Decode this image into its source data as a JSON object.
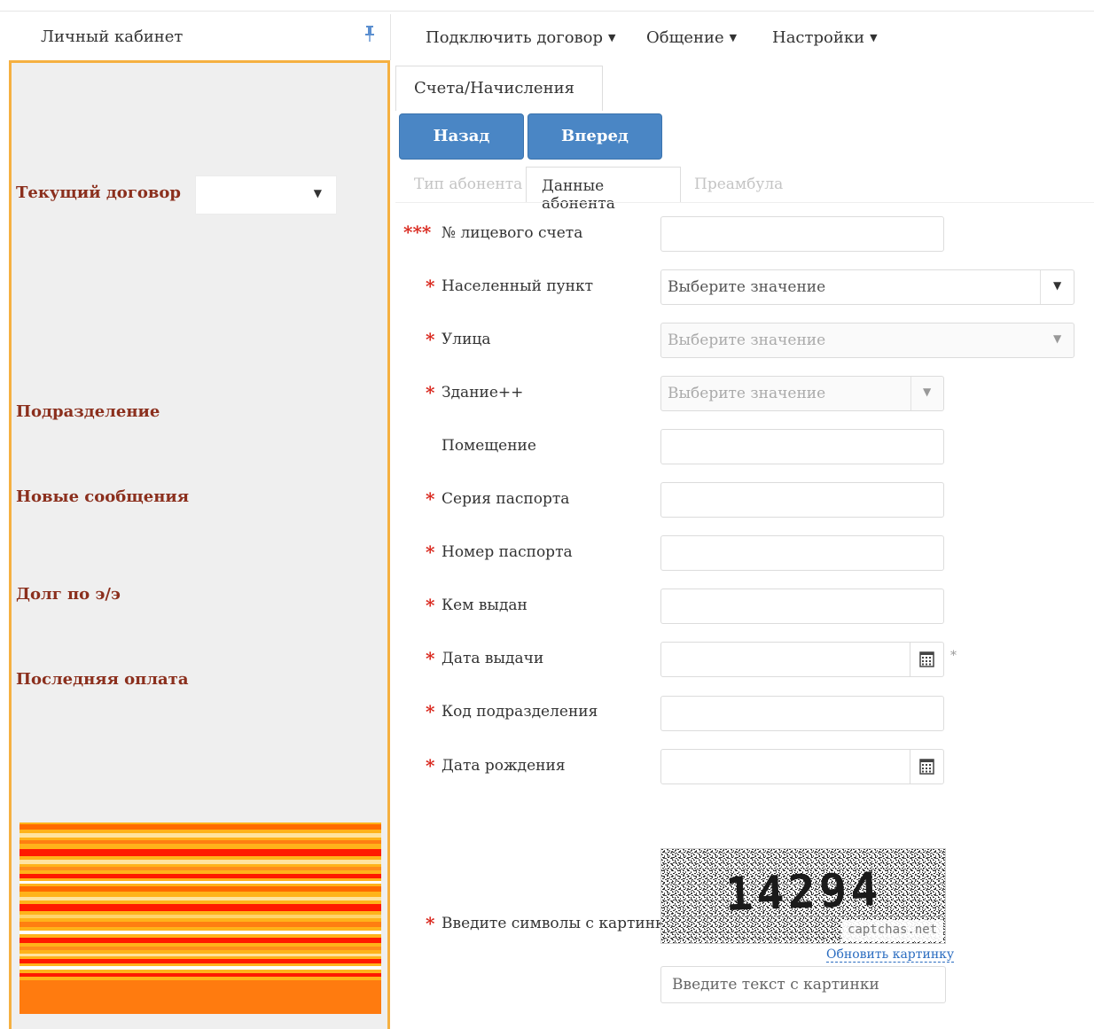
{
  "sidebar": {
    "title": "Личный кабинет",
    "current_contract_label": "Текущий договор",
    "current_contract_value": "",
    "division_label": "Подразделение",
    "new_messages_label": "Новые сообщения",
    "debt_label": "Долг по э/э",
    "last_payment_label": "Последняя оплата"
  },
  "nav": {
    "items": [
      {
        "label": "Подключить договор"
      },
      {
        "label": "Общение"
      },
      {
        "label": "Настройки"
      }
    ]
  },
  "tabs": {
    "main": "Счета/Начисления"
  },
  "buttons": {
    "back": "Назад",
    "forward": "Вперед"
  },
  "subtabs": [
    "Тип абонента",
    "Данные абонента",
    "Преамбула"
  ],
  "form": {
    "required_marker": "*",
    "account_marker": "***",
    "placeholder_select": "Выберите значение",
    "fields": [
      {
        "label": "№ лицевого счета",
        "value": ""
      },
      {
        "label": "Населенный пункт"
      },
      {
        "label": "Улица"
      },
      {
        "label": "Здание++"
      },
      {
        "label": "Помещение",
        "value": ""
      },
      {
        "label": "Серия паспорта",
        "value": ""
      },
      {
        "label": "Номер паспорта",
        "value": ""
      },
      {
        "label": "Кем выдан",
        "value": ""
      },
      {
        "label": "Дата выдачи",
        "value": ""
      },
      {
        "label": "Код подразделения",
        "value": ""
      },
      {
        "label": "Дата рождения",
        "value": ""
      }
    ],
    "captcha_label": "Введите символы с картинки",
    "captcha_text": "14294",
    "captcha_brand": "captchas.net",
    "captcha_refresh": "Обновить картинку",
    "captcha_placeholder": "Введите текст с картинки"
  },
  "colors": {
    "accent_blue": "#4a86c5",
    "label_brown": "#8b2f1d",
    "border_orange": "#f5b041",
    "required_red": "#d9261c"
  }
}
